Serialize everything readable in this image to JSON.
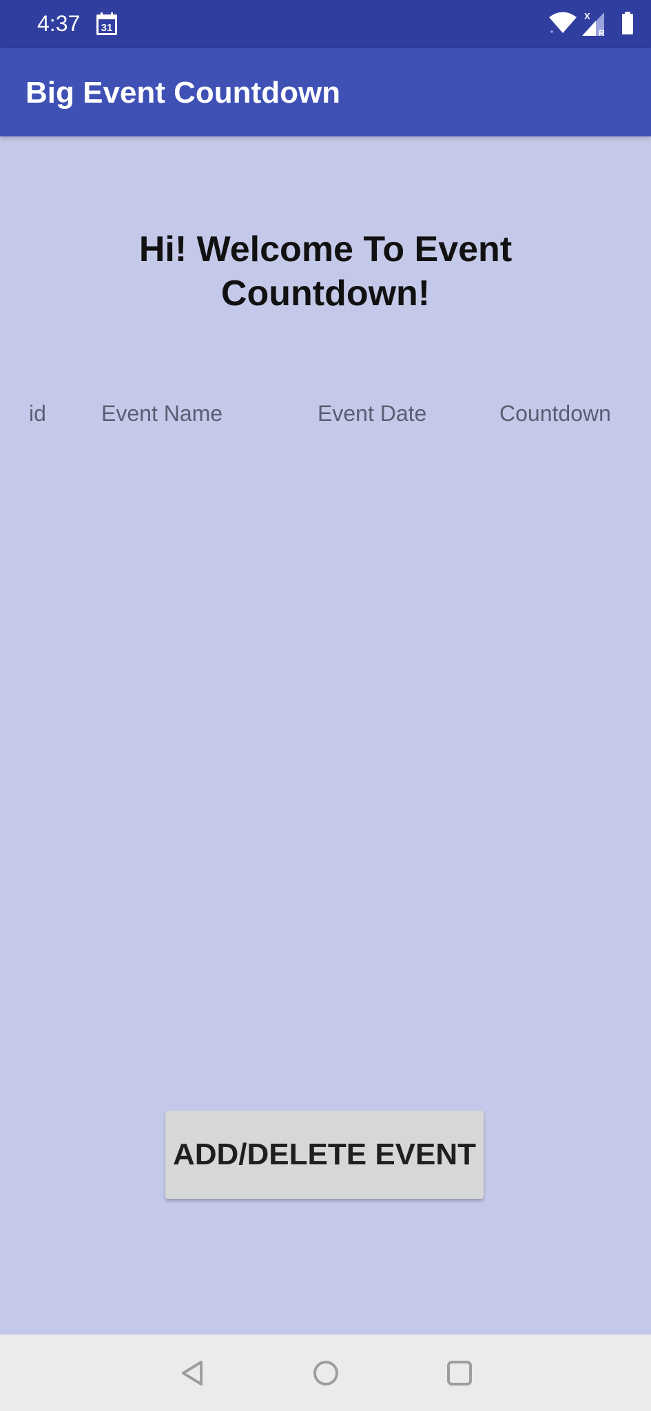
{
  "status_bar": {
    "time": "4:37",
    "calendar_day": "31",
    "signal_badge_x": "X",
    "signal_badge_r": "R"
  },
  "app_bar": {
    "title": "Big Event Countdown"
  },
  "main": {
    "welcome": "Hi! Welcome To Event Countdown!",
    "columns": [
      "id",
      "Event Name",
      "Event Date",
      "Countdown"
    ],
    "rows": []
  },
  "actions": {
    "add_delete_label": "ADD/DELETE EVENT"
  },
  "colors": {
    "status_bar": "#2f3e9f",
    "app_bar": "#3f51b5",
    "background": "#c5c9e9",
    "button": "#d6d7d7",
    "nav_bar": "#ebebeb"
  },
  "nav": {
    "icons": [
      "back-icon",
      "home-icon",
      "recents-icon"
    ]
  }
}
